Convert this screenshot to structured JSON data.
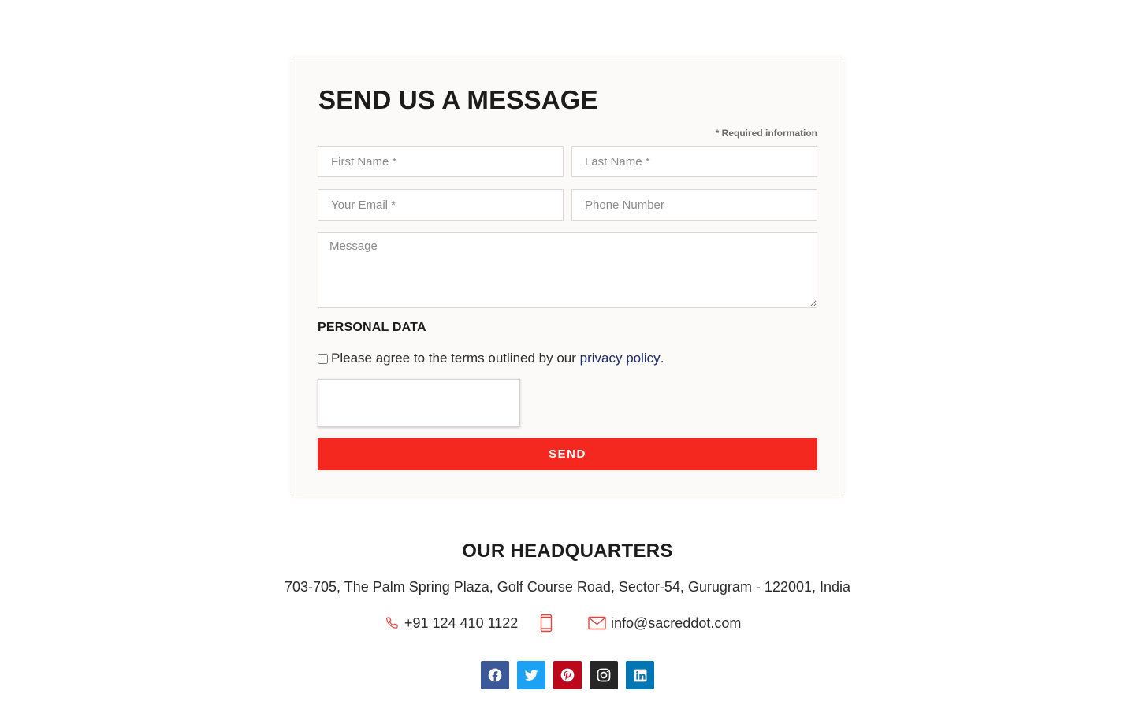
{
  "form": {
    "title": "SEND US A MESSAGE",
    "required_note": "* Required information",
    "fields": {
      "first_name": "First Name *",
      "last_name": "Last Name *",
      "email": "Your Email *",
      "phone": "Phone Number",
      "message": "Message"
    },
    "personal_data_title": "PERSONAL DATA",
    "agree_text": "Please agree to the terms outlined by our",
    "privacy_link": "privacy policy",
    "agree_suffix": ".",
    "agree_checked": false,
    "send_label": "SEND",
    "accent_color": "#f4281e"
  },
  "headquarters": {
    "title": "OUR HEADQUARTERS",
    "address": "703-705, The Palm Spring Plaza, Golf Course Road, Sector-54, Gurugram - 122001, India",
    "phone": "+91 124 410 1122",
    "email": "info@sacreddot.com",
    "icons": [
      "phone-icon",
      "mobile-icon",
      "mail-icon"
    ]
  },
  "social": [
    {
      "name": "facebook",
      "icon": "facebook-icon",
      "color": "#3b5998"
    },
    {
      "name": "twitter",
      "icon": "twitter-icon",
      "color": "#1da1f2"
    },
    {
      "name": "pinterest",
      "icon": "pinterest-icon",
      "color": "#bd081c"
    },
    {
      "name": "instagram",
      "icon": "instagram-icon",
      "color": "#262626"
    },
    {
      "name": "linkedin",
      "icon": "linkedin-icon",
      "color": "#0077b5"
    }
  ]
}
